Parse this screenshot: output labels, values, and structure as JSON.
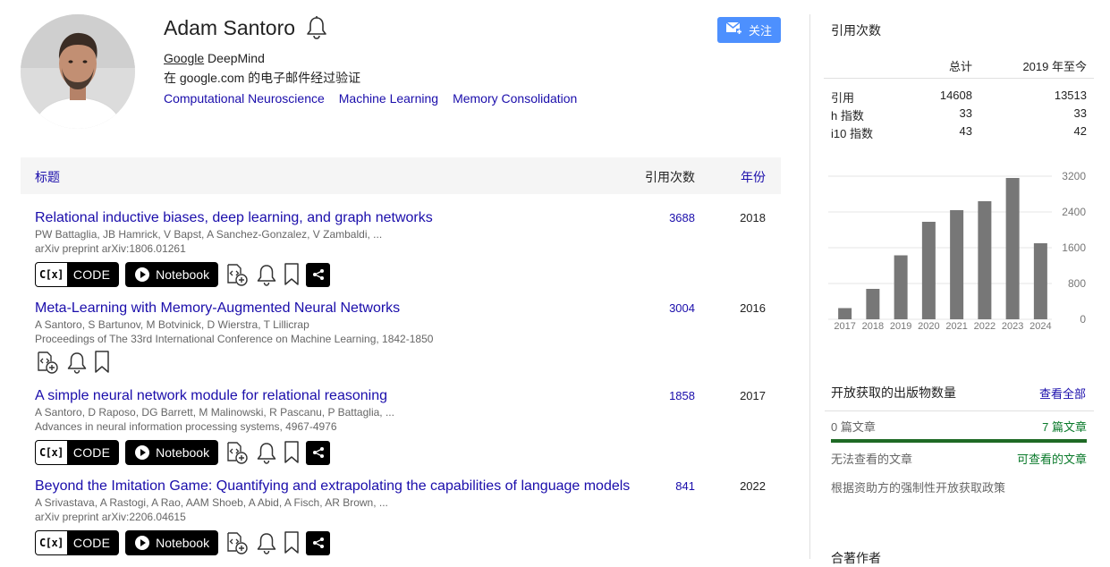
{
  "profile": {
    "name": "Adam Santoro",
    "affiliation_org": "Google",
    "affiliation_rest": " DeepMind",
    "verified": "在 google.com 的电子邮件经过验证",
    "interests": [
      "Computational Neuroscience",
      "Machine Learning",
      "Memory Consolidation"
    ],
    "follow_label": "关注"
  },
  "table": {
    "header_title": "标题",
    "header_cited": "引用次数",
    "header_year": "年份"
  },
  "articles": [
    {
      "title": "Relational inductive biases, deep learning, and graph networks",
      "authors": "PW Battaglia, JB Hamrick, V Bapst, A Sanchez-Gonzalez, V Zambaldi, ...",
      "venue": "arXiv preprint arXiv:1806.01261",
      "cites": "3688",
      "year": "2018",
      "has_code": true
    },
    {
      "title": "Meta-Learning with Memory-Augmented Neural Networks",
      "authors": "A Santoro, S Bartunov, M Botvinick, D Wierstra, T Lillicrap",
      "venue": "Proceedings of The 33rd International Conference on Machine Learning, 1842-1850",
      "cites": "3004",
      "year": "2016",
      "has_code": false
    },
    {
      "title": "A simple neural network module for relational reasoning",
      "authors": "A Santoro, D Raposo, DG Barrett, M Malinowski, R Pascanu, P Battaglia, ...",
      "venue": "Advances in neural information processing systems, 4967-4976",
      "cites": "1858",
      "year": "2017",
      "has_code": true
    },
    {
      "title": "Beyond the Imitation Game: Quantifying and extrapolating the capabilities of language models",
      "authors": "A Srivastava, A Rastogi, A Rao, AAM Shoeb, A Abid, A Fisch, AR Brown, ...",
      "venue": "arXiv preprint arXiv:2206.04615",
      "cites": "841",
      "year": "2022",
      "has_code": true
    }
  ],
  "action_labels": {
    "code_prefix": "C[x]",
    "code": "CODE",
    "notebook": "Notebook"
  },
  "sidebar": {
    "cited_by_title": "引用次数",
    "col_total": "总计",
    "col_since": "2019 年至今",
    "rows": [
      {
        "label": "引用",
        "total": "14608",
        "since": "13513"
      },
      {
        "label": "h 指数",
        "total": "33",
        "since": "33"
      },
      {
        "label": "i10 指数",
        "total": "43",
        "since": "42"
      }
    ],
    "open_access_title": "开放获取的出版物数量",
    "view_all": "查看全部",
    "not_available": "0 篇文章",
    "available": "7 篇文章",
    "not_available_label": "无法查看的文章",
    "available_label": "可查看的文章",
    "policy": "根据资助方的强制性开放获取政策",
    "coauthors_title": "合著作者"
  },
  "chart_data": {
    "type": "bar",
    "categories": [
      "2017",
      "2018",
      "2019",
      "2020",
      "2021",
      "2022",
      "2023",
      "2024"
    ],
    "values": [
      250,
      680,
      1430,
      2180,
      2440,
      2640,
      3160,
      1700
    ],
    "yticks": [
      0,
      800,
      1600,
      2400,
      3200
    ],
    "ylim": [
      0,
      3200
    ],
    "bar_color": "#777777"
  }
}
